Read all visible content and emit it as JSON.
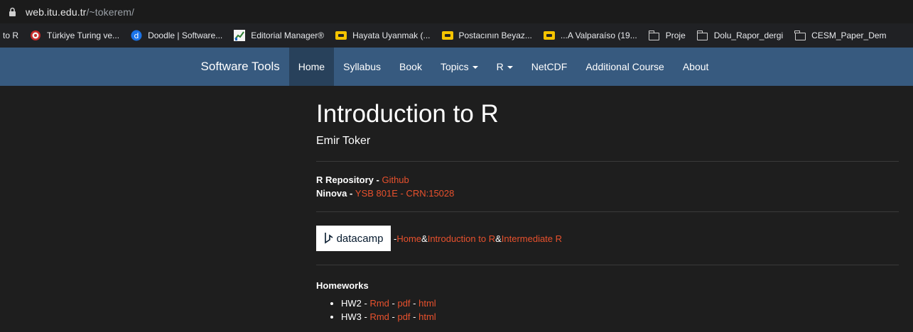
{
  "browser": {
    "url_host": "web.itu.edu.tr",
    "url_path": "/~tokerem/",
    "bookmarks": [
      {
        "label": "to R",
        "icon": "none"
      },
      {
        "label": "Türkiye Turing ve...",
        "icon": "seal-icon"
      },
      {
        "label": "Doodle | Software...",
        "icon": "doodle-icon"
      },
      {
        "label": "Editorial Manager®",
        "icon": "chart-icon"
      },
      {
        "label": "Hayata Uyanmak (...",
        "icon": "youtube-icon"
      },
      {
        "label": "Postacının Beyaz...",
        "icon": "youtube-icon"
      },
      {
        "label": "...A Valparaíso (19...",
        "icon": "youtube-icon"
      },
      {
        "label": "Proje",
        "icon": "folder-icon"
      },
      {
        "label": "Dolu_Rapor_dergi",
        "icon": "folder-icon"
      },
      {
        "label": "CESM_Paper_Dem",
        "icon": "folder-icon"
      }
    ]
  },
  "navbar": {
    "brand": "Software Tools",
    "items": [
      {
        "label": "Home",
        "active": true,
        "dropdown": false
      },
      {
        "label": "Syllabus",
        "active": false,
        "dropdown": false
      },
      {
        "label": "Book",
        "active": false,
        "dropdown": false
      },
      {
        "label": "Topics",
        "active": false,
        "dropdown": true
      },
      {
        "label": "R",
        "active": false,
        "dropdown": true
      },
      {
        "label": "NetCDF",
        "active": false,
        "dropdown": false
      },
      {
        "label": "Additional Course",
        "active": false,
        "dropdown": false
      },
      {
        "label": "About",
        "active": false,
        "dropdown": false
      }
    ]
  },
  "page": {
    "title": "Introduction to R",
    "author": "Emir Toker",
    "repo": {
      "label": "R Repository",
      "sep": " - ",
      "link": "Github"
    },
    "ninova": {
      "label": "Ninova",
      "sep": " - ",
      "link": "YSB 801E - CRN:15028"
    },
    "datacamp": {
      "logo_text": "datacamp",
      "sep": " - ",
      "links": [
        "Home",
        "Introduction to R",
        "Intermediate R"
      ],
      "joiner": " & "
    },
    "homeworks": {
      "title": "Homeworks",
      "items": [
        {
          "name": "HW2",
          "links": [
            "Rmd",
            "pdf",
            "html"
          ]
        },
        {
          "name": "HW3",
          "links": [
            "Rmd",
            "pdf",
            "html"
          ]
        }
      ],
      "sep": " - "
    }
  },
  "colors": {
    "background": "#1e1e1e",
    "navbar": "#375a7f",
    "nav_active": "#28415b",
    "link": "#e8512d"
  }
}
